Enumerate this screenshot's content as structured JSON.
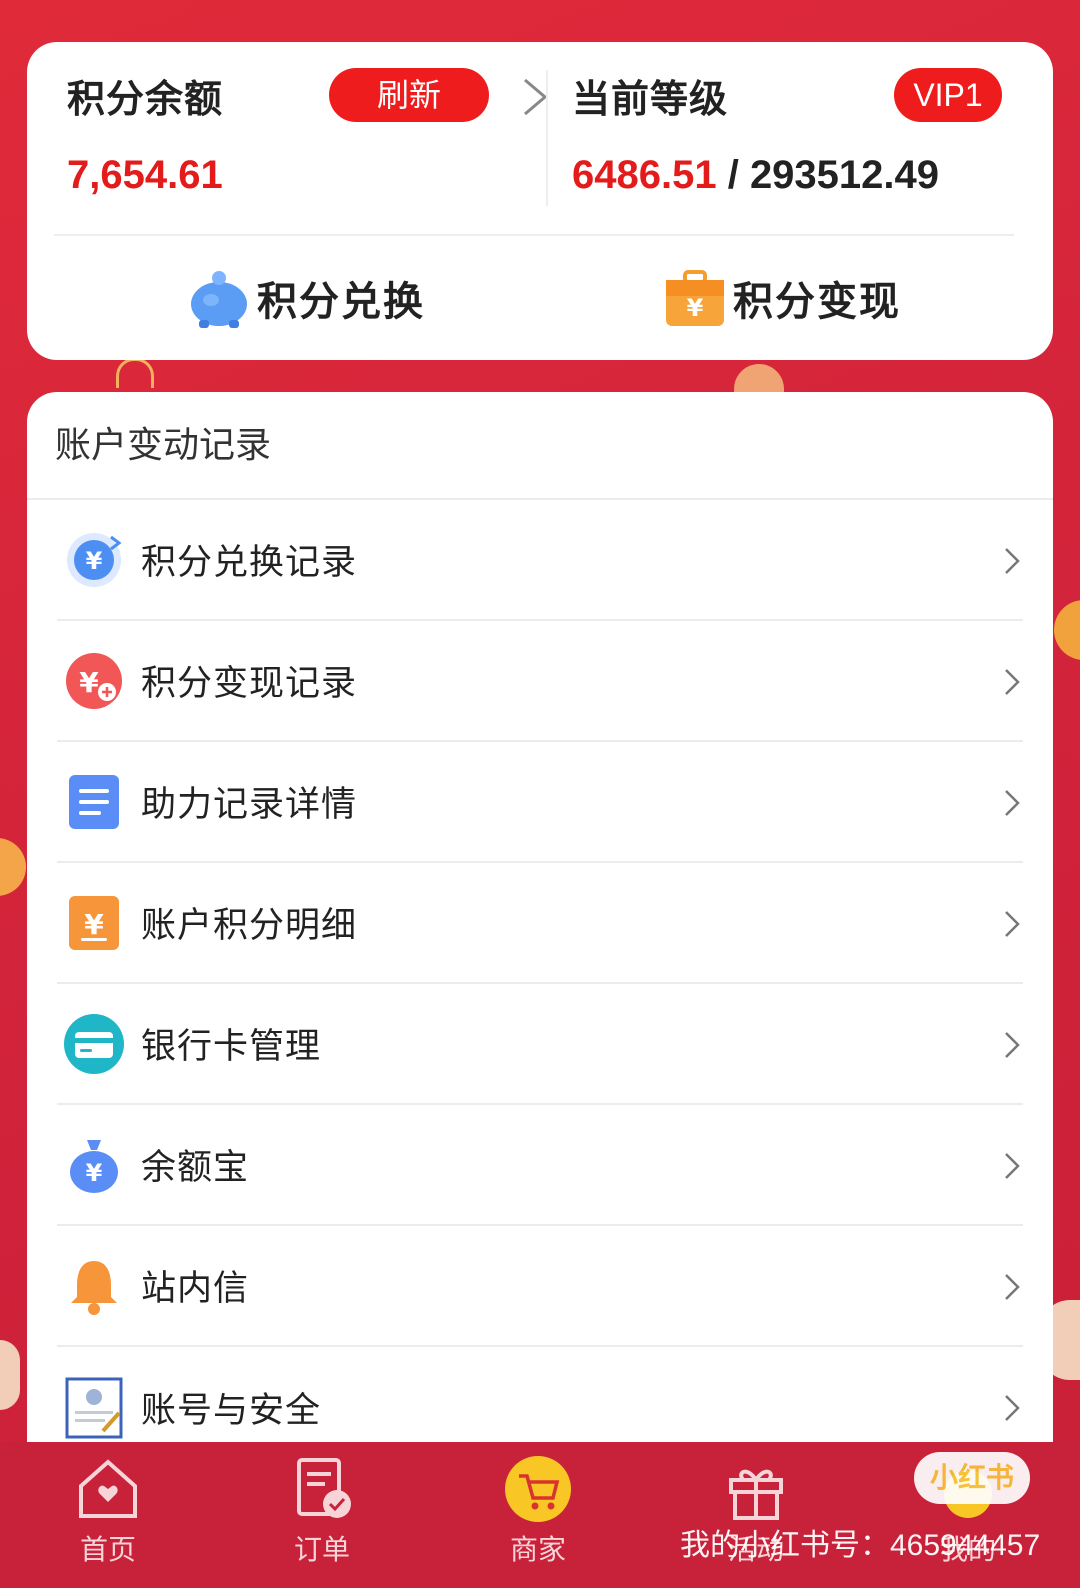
{
  "balance": {
    "title": "积分余额",
    "refresh_label": "刷新",
    "value": "7,654.61"
  },
  "level": {
    "title": "当前等级",
    "badge": "VIP1",
    "current": "6486.51",
    "separator": " / ",
    "target": "293512.49"
  },
  "actions": {
    "exchange_label": "积分兑换",
    "cash_label": "积分变现"
  },
  "records": {
    "header": "账户变动记录",
    "items": [
      {
        "label": "积分兑换记录",
        "icon": "yuan-exchange-icon"
      },
      {
        "label": "积分变现记录",
        "icon": "yuan-cash-icon"
      },
      {
        "label": "助力记录详情",
        "icon": "document-icon"
      },
      {
        "label": "账户积分明细",
        "icon": "ledger-icon"
      },
      {
        "label": "银行卡管理",
        "icon": "bank-card-icon"
      },
      {
        "label": "余额宝",
        "icon": "money-bag-icon"
      },
      {
        "label": "站内信",
        "icon": "bell-icon"
      },
      {
        "label": "账号与安全",
        "icon": "certificate-icon"
      }
    ]
  },
  "nav": {
    "home": "首页",
    "order": "订单",
    "shop": "商家",
    "gift": "活动",
    "mine": "我的"
  },
  "watermark": {
    "text": "我的小红书号：465944457",
    "badge": "小红书"
  },
  "colors": {
    "accent_red": "#ee1c1c",
    "background": "#d3243a",
    "nav_bg": "#c8213a"
  }
}
